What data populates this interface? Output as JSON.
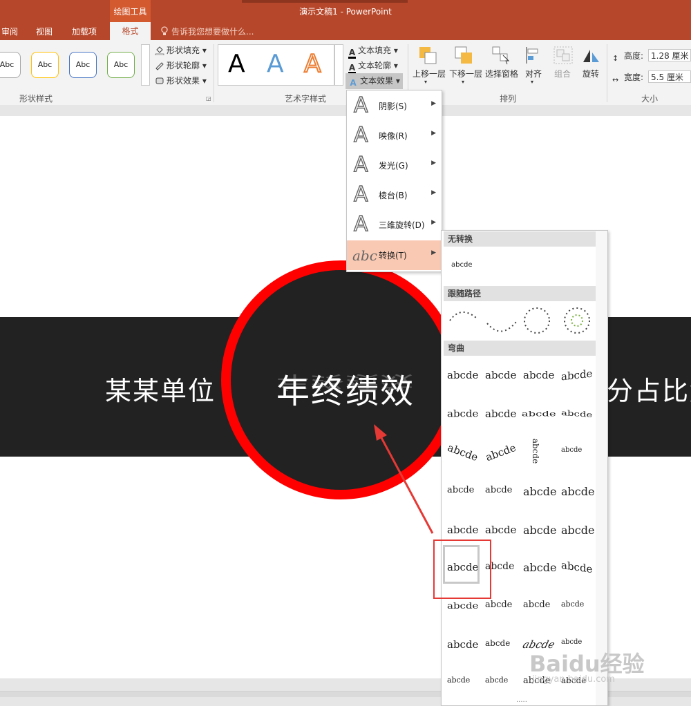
{
  "titlebar": {
    "tool_group": "绘图工具",
    "document_title": "演示文稿1 - PowerPoint"
  },
  "tabs": {
    "review": "审阅",
    "view": "视图",
    "addins": "加载项",
    "format": "格式",
    "tell_me": "告诉我您想要做什么..."
  },
  "ribbon": {
    "shape_styles": {
      "label": "形状样式",
      "samples": [
        "Abc",
        "Abc",
        "Abc",
        "Abc"
      ],
      "sample_border_colors": [
        "#a5a5a5",
        "#ffc000",
        "#4472c4",
        "#70ad47"
      ],
      "fill": "形状填充",
      "outline": "形状轮廓",
      "effects": "形状效果"
    },
    "wordart_styles": {
      "label": "艺术字样式",
      "samples": [
        "A",
        "A",
        "A"
      ],
      "sample_colors": [
        "#000000",
        "#5b9bd5",
        "#ed7d31"
      ],
      "text_fill": "文本填充",
      "text_outline": "文本轮廓",
      "text_effects": "文本效果"
    },
    "arrange": {
      "label": "排列",
      "bring_forward": "上移一层",
      "send_backward": "下移一层",
      "selection_pane": "选择窗格",
      "align": "对齐",
      "group": "组合",
      "rotate": "旋转"
    },
    "size": {
      "label": "大小",
      "height_label": "高度:",
      "height_value": "1.28 厘米",
      "width_label": "宽度:",
      "width_value": "5.5 厘米"
    }
  },
  "text_effects_menu": {
    "items": [
      {
        "label": "阴影(S)",
        "icon": "shadow-A-icon"
      },
      {
        "label": "映像(R)",
        "icon": "reflection-A-icon"
      },
      {
        "label": "发光(G)",
        "icon": "glow-A-icon"
      },
      {
        "label": "棱台(B)",
        "icon": "bevel-A-icon"
      },
      {
        "label": "三维旋转(D)",
        "icon": "3d-rotation-A-icon"
      },
      {
        "label": "转换(T)",
        "icon": "transform-abc-icon"
      }
    ],
    "transform_icon_text": "abc"
  },
  "transform_gallery": {
    "no_transform_header": "无转换",
    "no_transform_sample": "abcde",
    "follow_path_header": "跟随路径",
    "warp_header": "弯曲",
    "warp_sample": "abcde",
    "dots": "....."
  },
  "slide": {
    "left_text": "某某单位",
    "title": "年终绩效",
    "right_text": "分占比解",
    "circle_border_color": "#ff0000",
    "band_color": "#222222"
  },
  "watermark": {
    "brand": "Baidu经验",
    "url": "jingyan.baidu.com"
  }
}
